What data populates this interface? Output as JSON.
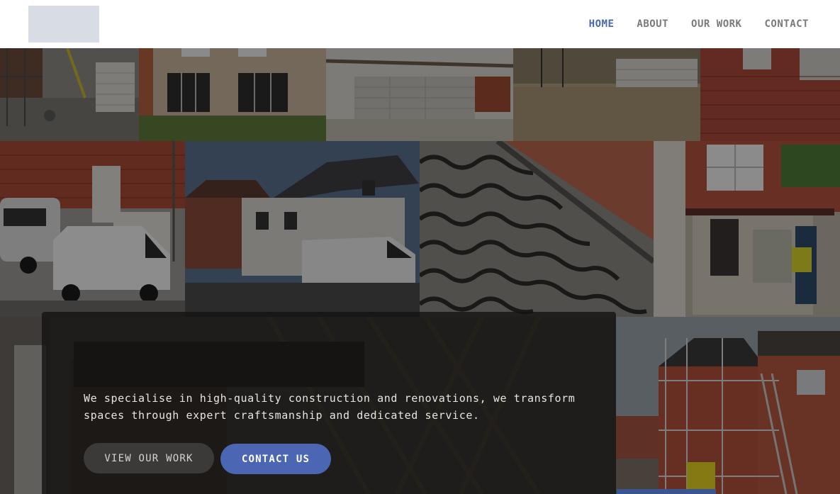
{
  "header": {
    "logo_name": "company-logo",
    "nav": [
      {
        "label": "HOME",
        "active": true
      },
      {
        "label": "ABOUT",
        "active": false
      },
      {
        "label": "OUR WORK",
        "active": false
      },
      {
        "label": "CONTACT",
        "active": false
      }
    ]
  },
  "hero": {
    "description": "We specialise in high-quality construction and renovations, we transform spaces through expert craftsmanship and dedicated service.",
    "buttons": {
      "view_work": "VIEW OUR WORK",
      "contact": "CONTACT US"
    }
  },
  "colors": {
    "accent": "#4b67b3",
    "nav_active": "#4a66b0",
    "nav_inactive": "#7a7a7a",
    "header_bg": "#ffffff",
    "card_bg": "#141312"
  },
  "gallery": {
    "photos": [
      "scaffold-and-block-pallets",
      "brick-extension-with-patio-doors",
      "block-wall-foundations",
      "ground-floor-site-blocks",
      "brick-wall-corner",
      "vans-at-brick-site",
      "new-houses-with-van",
      "roof-tiles-closeup",
      "house-renovation-worker",
      "roof-trusses-site",
      "scaffolded-house-extension"
    ]
  }
}
